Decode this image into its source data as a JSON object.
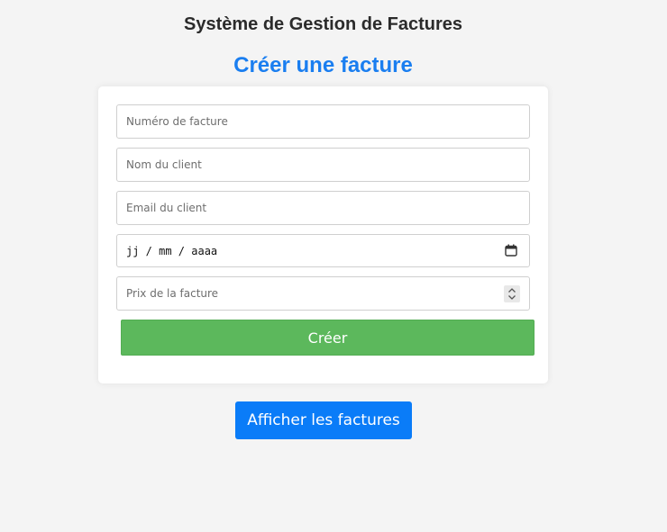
{
  "header": {
    "app_title": "Système de Gestion de Factures",
    "form_title": "Créer une facture"
  },
  "form": {
    "invoice_number": {
      "placeholder": "Numéro de facture",
      "value": ""
    },
    "client_name": {
      "placeholder": "Nom du client",
      "value": ""
    },
    "client_email": {
      "placeholder": "Email du client",
      "value": ""
    },
    "date": {
      "display": "jj / mm / aaaa"
    },
    "price": {
      "placeholder": "Prix de la facture",
      "value": ""
    },
    "create_label": "Créer"
  },
  "actions": {
    "show_invoices_label": "Afficher les factures"
  },
  "colors": {
    "accent": "#1a7ef0",
    "create_button": "#5cb85c",
    "show_button": "#0a7cf8",
    "background": "#f4f4f4"
  },
  "icons": {
    "date": "calendar-icon",
    "price": "spinner-icon"
  }
}
